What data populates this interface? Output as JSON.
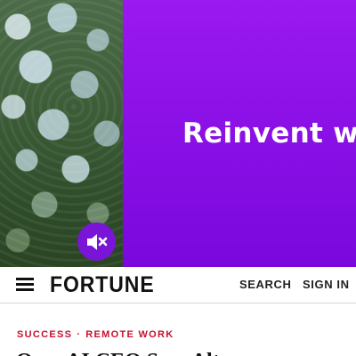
{
  "ad": {
    "headline": "Reinvent wh",
    "mute_icon": "speaker-muted-icon",
    "colors": {
      "purple": "#8a10e6",
      "mute_bg": "#7a14d6"
    }
  },
  "header": {
    "menu_icon": "hamburger-menu-icon",
    "logo": "FORTUNE",
    "search_label": "SEARCH",
    "signin_label": "SIGN IN"
  },
  "article": {
    "kicker": {
      "section": "SUCCESS",
      "separator": "·",
      "topic": "REMOTE WORK",
      "color": "#c8102e"
    },
    "headline": "OpenAI CEO Sam Altm"
  }
}
